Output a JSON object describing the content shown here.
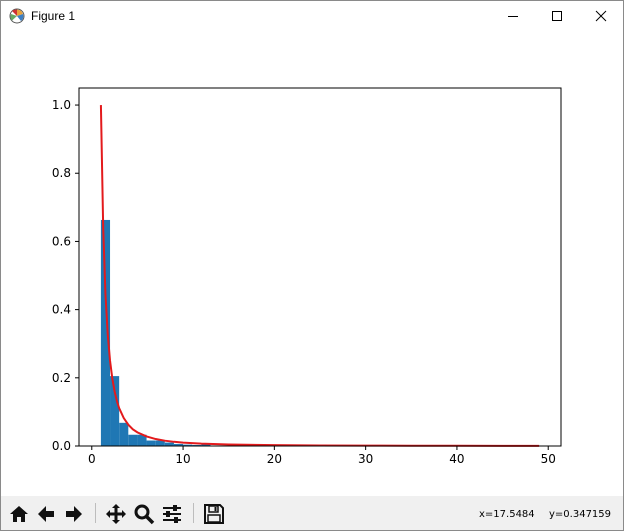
{
  "window": {
    "title": "Figure 1",
    "icons": {
      "app": "matplotlib-icon",
      "minimize": "minimize-icon",
      "maximize": "maximize-icon",
      "close": "close-icon"
    }
  },
  "chart_data": {
    "type": "bar",
    "description_free": true,
    "xlim": [
      -1.4,
      51.4
    ],
    "ylim": [
      0,
      1.05
    ],
    "xticks": [
      0,
      10,
      20,
      30,
      40,
      50
    ],
    "yticks": [
      0.0,
      0.2,
      0.4,
      0.6,
      0.8,
      1.0
    ],
    "xtick_labels": [
      "0",
      "10",
      "20",
      "30",
      "40",
      "50"
    ],
    "ytick_labels": [
      "0.0",
      "0.2",
      "0.4",
      "0.6",
      "0.8",
      "1.0"
    ],
    "grid": false,
    "bar_color": "#1f77b4",
    "line_color": "#e31a1c",
    "histogram": {
      "bin_width": 1,
      "bin_starts": [
        1,
        2,
        3,
        4,
        5,
        6,
        7,
        8,
        9,
        10,
        11,
        12
      ],
      "values": [
        0.663,
        0.205,
        0.068,
        0.033,
        0.033,
        0.016,
        0.016,
        0.01,
        0.006,
        0.004,
        0.003,
        0.005
      ]
    },
    "curve": {
      "name": "",
      "formula_points_x": [
        1,
        1.25,
        1.5,
        1.75,
        2,
        2.25,
        2.5,
        2.75,
        3,
        3.5,
        4,
        4.5,
        5,
        6,
        7,
        8,
        9,
        10,
        12,
        15,
        20,
        25,
        30,
        35,
        40,
        45,
        49
      ],
      "formula_points_y": [
        1.0,
        0.64,
        0.444,
        0.327,
        0.25,
        0.198,
        0.16,
        0.132,
        0.111,
        0.082,
        0.0625,
        0.049,
        0.04,
        0.028,
        0.0204,
        0.0156,
        0.0123,
        0.01,
        0.0069,
        0.0044,
        0.0025,
        0.0016,
        0.0011,
        0.0008,
        0.0006,
        0.0005,
        0.0004
      ]
    }
  },
  "toolbar": {
    "buttons": [
      {
        "name": "home-button",
        "icon": "home-icon"
      },
      {
        "name": "back-button",
        "icon": "arrow-left-icon"
      },
      {
        "name": "forward-button",
        "icon": "arrow-right-icon"
      },
      {
        "name": "pan-button",
        "icon": "move-icon"
      },
      {
        "name": "zoom-button",
        "icon": "magnifier-icon"
      },
      {
        "name": "configure-subplots-button",
        "icon": "sliders-icon"
      },
      {
        "name": "save-button",
        "icon": "floppy-disk-icon"
      }
    ],
    "coord_x": "x=17.5484",
    "coord_y": "y=0.347159"
  }
}
